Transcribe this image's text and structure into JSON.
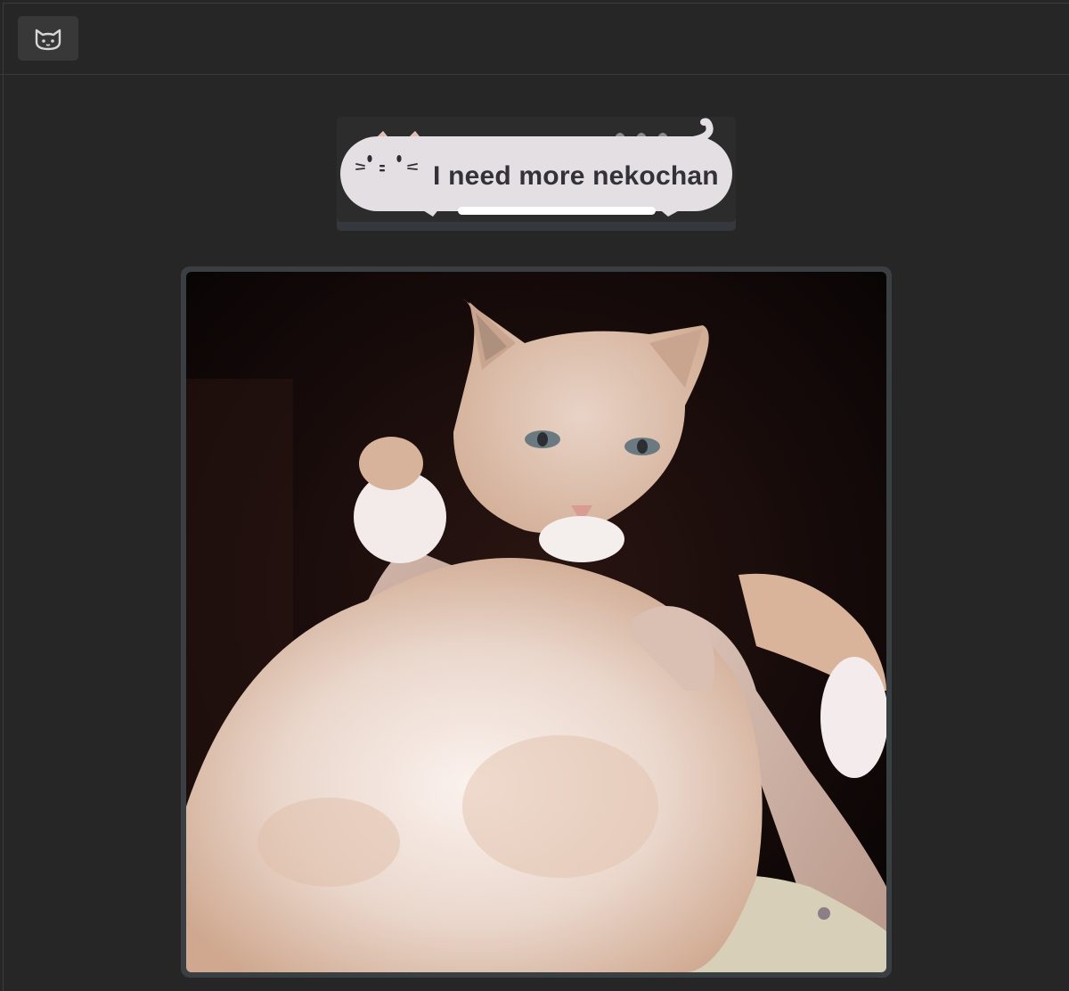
{
  "toolbar": {
    "button_icon": "cat-face-icon"
  },
  "banner": {
    "text": "I need more nekochan",
    "icon": "cat-bubble-icon"
  },
  "photo": {
    "alt": "Fat orange cat held up by hands",
    "icon": "cat-photo"
  },
  "colors": {
    "background": "#262626",
    "button_bg": "#383838",
    "bubble_fill": "#e3dfe2",
    "text": "#333238"
  }
}
